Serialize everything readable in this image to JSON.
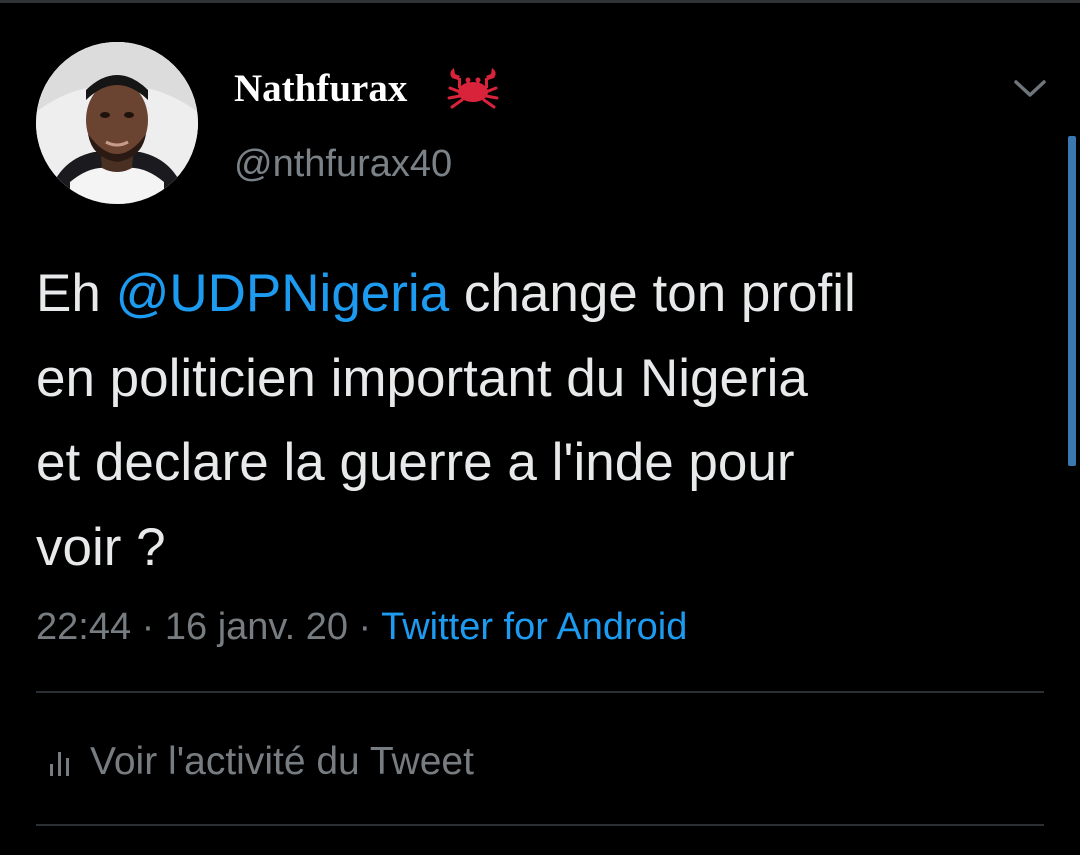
{
  "tweet": {
    "author": {
      "display_name": "Nathfurax",
      "handle": "@nthfurax40",
      "name_emoji": "crab-icon",
      "avatar": "profile-photo"
    },
    "text": {
      "line1_before": "Eh ",
      "mention": "@UDPNigeria",
      "line1_after": " change ton profil",
      "line2": "en politicien important du Nigeria",
      "line3": "et declare la guerre a l'inde pour",
      "line4": "voir ?"
    },
    "time": "22:44",
    "separator": " · ",
    "date": "16 janv. 20",
    "source": "Twitter for Android",
    "activity_label": "Voir l'activité du Tweet"
  },
  "icons": {
    "menu": "chevron-down-icon",
    "activity": "bar-chart-icon"
  },
  "colors": {
    "background": "#000000",
    "text": "#e7e9ea",
    "muted": "#767c80",
    "link": "#1d9bf0",
    "crab": "#d8233a",
    "divider": "#2b2f33"
  }
}
